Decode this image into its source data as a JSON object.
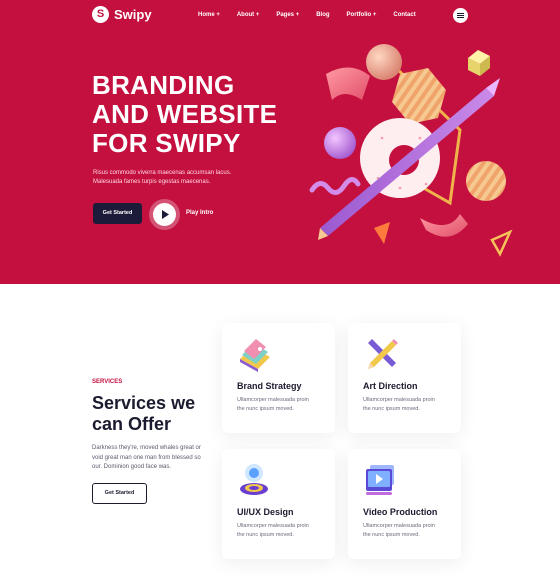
{
  "brand": {
    "name": "Swipy",
    "logo_letter": "S"
  },
  "nav": {
    "items": [
      {
        "label": "Home +"
      },
      {
        "label": "About +"
      },
      {
        "label": "Pages +"
      },
      {
        "label": "Blog"
      },
      {
        "label": "Portfolio +"
      },
      {
        "label": "Contact"
      }
    ]
  },
  "hero": {
    "title_lines": [
      "BRANDING",
      "AND WEBSITE",
      "FOR SWIPY"
    ],
    "subtitle_lines": [
      "Risus commodo viverra maecenas accumsan lacus.",
      "Malesuada fames turpis egestas maecenas."
    ],
    "cta_label": "Get Started",
    "play_label": "Play Intro"
  },
  "services": {
    "label": "SERVICES",
    "title_lines": [
      "Services we",
      "can Offer"
    ],
    "description_lines": [
      "Darkness they're, moved whales great or",
      "void great man one man from blessed so",
      "our. Dominion good face was."
    ],
    "cta_label": "Get Started",
    "cards": [
      {
        "title": "Brand Strategy",
        "desc_lines": [
          "Ullamcorper malesuada proin",
          "the nunc ipsum moved."
        ],
        "icon": "palette-swatch-icon"
      },
      {
        "title": "Art Direction",
        "desc_lines": [
          "Ullamcorper malesuada proin",
          "the nunc ipsum moved."
        ],
        "icon": "pencil-ruler-icon"
      },
      {
        "title": "UI/UX Design",
        "desc_lines": [
          "Ullamcorper malesuada proin",
          "the nunc ipsum moved."
        ],
        "icon": "ring-design-icon"
      },
      {
        "title": "Video Production",
        "desc_lines": [
          "Ullamcorper malesuada proin",
          "the nunc ipsum moved."
        ],
        "icon": "video-player-icon"
      }
    ]
  },
  "colors": {
    "brand": "#c4103f",
    "dark": "#1d1b3a",
    "text": "#1b1b2f",
    "muted": "#6a6a7c"
  }
}
